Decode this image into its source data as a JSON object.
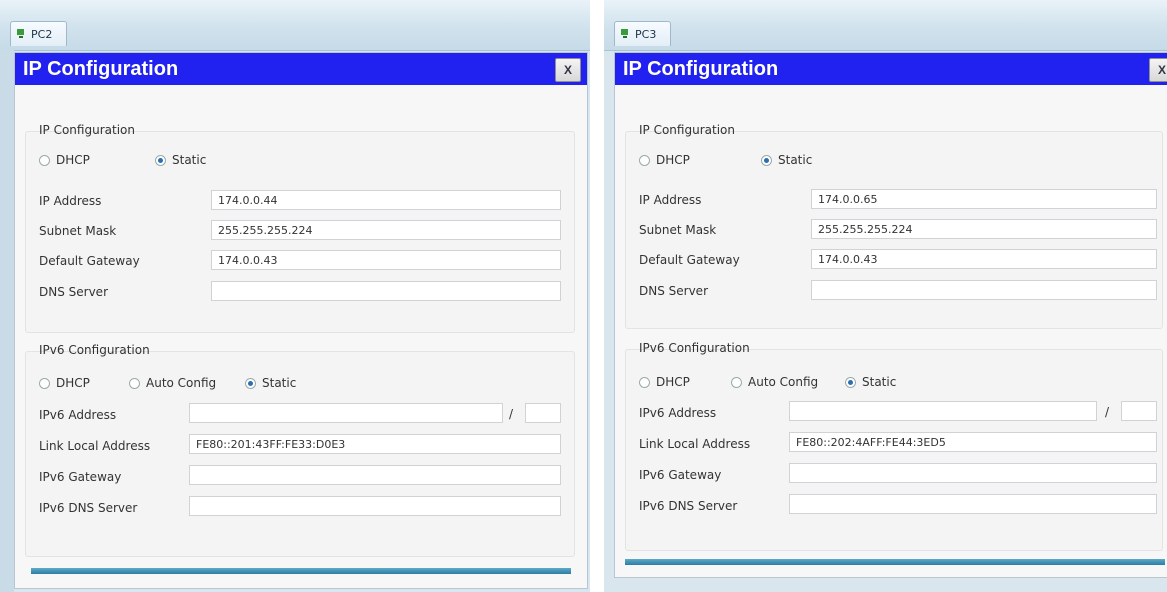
{
  "left": {
    "tab_label": "PC2",
    "dialog_title": "IP Configuration",
    "close_label": "X",
    "ipv4": {
      "section_title": "IP Configuration",
      "dhcp_label": "DHCP",
      "static_label": "Static",
      "selected_mode": "Static",
      "ip_address_label": "IP Address",
      "ip_address": "174.0.0.44",
      "subnet_mask_label": "Subnet Mask",
      "subnet_mask": "255.255.255.224",
      "default_gateway_label": "Default Gateway",
      "default_gateway": "174.0.0.43",
      "dns_server_label": "DNS Server",
      "dns_server": ""
    },
    "ipv6": {
      "section_title": "IPv6 Configuration",
      "dhcp_label": "DHCP",
      "auto_config_label": "Auto Config",
      "static_label": "Static",
      "selected_mode": "Static",
      "address_label": "IPv6 Address",
      "address": "",
      "prefix_separator": "/",
      "prefix_length": "",
      "link_local_label": "Link Local Address",
      "link_local": "FE80::201:43FF:FE33:D0E3",
      "gateway_label": "IPv6 Gateway",
      "gateway": "",
      "dns_label": "IPv6 DNS Server",
      "dns": ""
    }
  },
  "right": {
    "tab_label": "PC3",
    "dialog_title": "IP Configuration",
    "close_label": "X",
    "ipv4": {
      "section_title": "IP Configuration",
      "dhcp_label": "DHCP",
      "static_label": "Static",
      "selected_mode": "Static",
      "ip_address_label": "IP Address",
      "ip_address": "174.0.0.65",
      "subnet_mask_label": "Subnet Mask",
      "subnet_mask": "255.255.255.224",
      "default_gateway_label": "Default Gateway",
      "default_gateway": "174.0.0.43",
      "dns_server_label": "DNS Server",
      "dns_server": ""
    },
    "ipv6": {
      "section_title": "IPv6 Configuration",
      "dhcp_label": "DHCP",
      "auto_config_label": "Auto Config",
      "static_label": "Static",
      "selected_mode": "Static",
      "address_label": "IPv6 Address",
      "address": "",
      "prefix_separator": "/",
      "prefix_length": "",
      "link_local_label": "Link Local Address",
      "link_local": "FE80::202:4AFF:FE44:3ED5",
      "gateway_label": "IPv6 Gateway",
      "gateway": "",
      "dns_label": "IPv6 DNS Server",
      "dns": ""
    }
  },
  "colors": {
    "dialog_header": "#2222f0",
    "window_frame": "#d7e7f1",
    "bottom_bar": "#2c7ea2"
  },
  "icons": [
    "pc-icon",
    "close-icon",
    "radio-icon"
  ]
}
